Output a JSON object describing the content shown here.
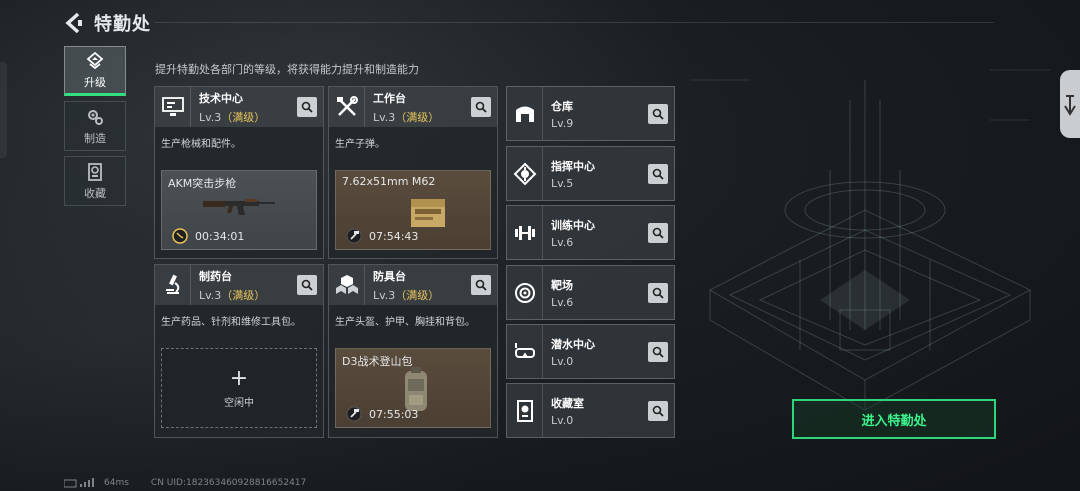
{
  "header": {
    "title": "特勤处"
  },
  "subtitle": "提升特勤处各部门的等级，将获得能力提升和制造能力",
  "sidebar": [
    {
      "label": "升级",
      "icon": "upgrade-icon",
      "active": true
    },
    {
      "label": "制造",
      "icon": "gears-icon",
      "active": false
    },
    {
      "label": "收藏",
      "icon": "collection-icon",
      "active": false
    }
  ],
  "departments": [
    {
      "name": "技术中心",
      "level": "Lv.3",
      "max": "（满级）",
      "icon": "computer-icon",
      "desc": "生产枪械和配件。",
      "slot": {
        "item": "AKM突击步枪",
        "time": "00:34:01"
      }
    },
    {
      "name": "工作台",
      "level": "Lv.3",
      "max": "（满级）",
      "icon": "tools-icon",
      "desc": "生产子弹。",
      "slot": {
        "item": "7.62x51mm M62",
        "time": "07:54:43"
      }
    },
    {
      "name": "制药台",
      "level": "Lv.3",
      "max": "（满级）",
      "icon": "microscope-icon",
      "desc": "生产药品、针剂和维修工具包。",
      "slot": {
        "plus": "+",
        "idle": "空闲中"
      }
    },
    {
      "name": "防具台",
      "level": "Lv.3",
      "max": "（满级）",
      "icon": "cubes-icon",
      "desc": "生产头盔、护甲、胸挂和背包。",
      "slot": {
        "item": "D3战术登山包",
        "time": "07:55:03"
      }
    }
  ],
  "facilities": [
    {
      "name": "仓库",
      "level": "Lv.9",
      "icon": "warehouse-icon"
    },
    {
      "name": "指挥中心",
      "level": "Lv.5",
      "icon": "command-icon"
    },
    {
      "name": "训练中心",
      "level": "Lv.6",
      "icon": "dumbbell-icon"
    },
    {
      "name": "靶场",
      "level": "Lv.6",
      "icon": "target-icon"
    },
    {
      "name": "潜水中心",
      "level": "Lv.0",
      "icon": "diving-mask-icon"
    },
    {
      "name": "收藏室",
      "level": "Lv.0",
      "icon": "collection-room-icon"
    }
  ],
  "enter_button": "进入特勤处",
  "footer": {
    "ping": "64ms",
    "uid": "CN UID:18236346092881665241​7"
  },
  "colors": {
    "accent": "#2fe07f",
    "max_level": "#e7c35a"
  }
}
